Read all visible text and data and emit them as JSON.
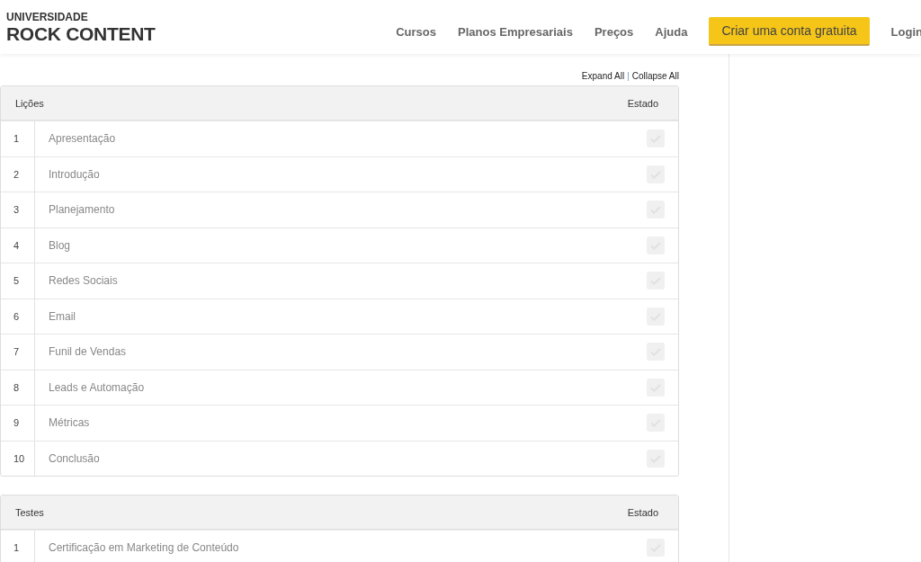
{
  "header": {
    "logo_top": "UNIVERSIDADE",
    "logo_bottom": "ROCK CONTENT",
    "nav": [
      "Cursos",
      "Planos Empresariais",
      "Preços",
      "Ajuda"
    ],
    "cta": "Criar uma conta gratuita",
    "login": "Login"
  },
  "controls": {
    "expand": "Expand All",
    "separator": "|",
    "collapse": "Collapse All"
  },
  "tables": [
    {
      "title": "Lições",
      "status_heading": "Estado",
      "rows": [
        {
          "number": "1",
          "name": "Apresentação",
          "completed": false
        },
        {
          "number": "2",
          "name": "Introdução",
          "completed": false
        },
        {
          "number": "3",
          "name": "Planejamento",
          "completed": false
        },
        {
          "number": "4",
          "name": "Blog",
          "completed": false
        },
        {
          "number": "5",
          "name": "Redes Sociais",
          "completed": false
        },
        {
          "number": "6",
          "name": "Email",
          "completed": false
        },
        {
          "number": "7",
          "name": "Funil de Vendas",
          "completed": false
        },
        {
          "number": "8",
          "name": "Leads e Automação",
          "completed": false
        },
        {
          "number": "9",
          "name": "Métricas",
          "completed": false
        },
        {
          "number": "10",
          "name": "Conclusão",
          "completed": false
        }
      ]
    },
    {
      "title": "Testes",
      "status_heading": "Estado",
      "rows": [
        {
          "number": "1",
          "name": "Certificação em Marketing de Conteúdo",
          "completed": false
        }
      ]
    }
  ]
}
